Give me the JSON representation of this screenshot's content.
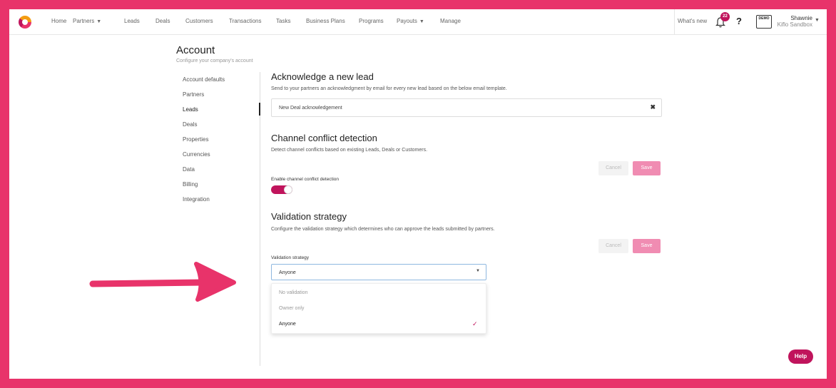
{
  "nav": {
    "items": [
      {
        "label": "Home",
        "caret": false
      },
      {
        "label": "Partners",
        "caret": true
      },
      {
        "label": "Leads",
        "caret": false
      },
      {
        "label": "Deals",
        "caret": false
      },
      {
        "label": "Customers",
        "caret": false
      },
      {
        "label": "Transactions",
        "caret": false
      },
      {
        "label": "Tasks",
        "caret": false
      },
      {
        "label": "Business Plans",
        "caret": false
      },
      {
        "label": "Programs",
        "caret": false
      },
      {
        "label": "Payouts",
        "caret": true
      },
      {
        "label": "Manage",
        "caret": false
      }
    ],
    "whats_new": "What's new",
    "notification_count": "22",
    "help_glyph": "?",
    "demo_icon_text": "DEMO",
    "user_name": "Shawnie",
    "user_org": "Kiflo Sandbox"
  },
  "page": {
    "title": "Account",
    "subtitle": "Configure your company's account"
  },
  "sidebar": {
    "items": [
      {
        "label": "Account defaults"
      },
      {
        "label": "Partners"
      },
      {
        "label": "Leads",
        "active": true
      },
      {
        "label": "Deals"
      },
      {
        "label": "Properties"
      },
      {
        "label": "Currencies"
      },
      {
        "label": "Data"
      },
      {
        "label": "Billing"
      },
      {
        "label": "Integration"
      }
    ]
  },
  "acknowledge": {
    "title": "Acknowledge a new lead",
    "description": "Send to your partners an acknowledgment by email for every new lead based on the below email template.",
    "template_value": "New Deal acknowledgement",
    "clear_glyph": "✖"
  },
  "conflict": {
    "title": "Channel conflict detection",
    "description": "Detect channel conflicts based on existing Leads, Deals or Customers.",
    "cancel_label": "Cancel",
    "save_label": "Save",
    "toggle_label": "Enable channel conflict detection",
    "toggle_on": true
  },
  "validation": {
    "title": "Validation strategy",
    "description": "Configure the validation strategy which determines who can approve the leads submitted by partners.",
    "cancel_label": "Cancel",
    "save_label": "Save",
    "field_label": "Validation strategy",
    "selected_value": "Anyone",
    "options": [
      "No validation",
      "Owner only",
      "Anyone"
    ],
    "check_glyph": "✓"
  },
  "help_label": "Help",
  "colors": {
    "brand": "#e8336a",
    "accent": "#c0145c",
    "save_disabled": "#f08cb2"
  }
}
